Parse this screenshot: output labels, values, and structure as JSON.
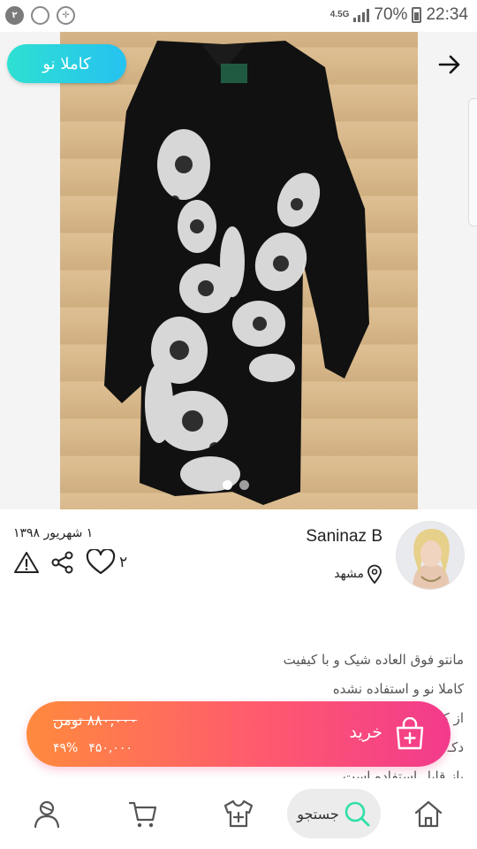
{
  "status_bar": {
    "notification_count": "۲",
    "network": "4.5G",
    "battery": "70%",
    "time": "22:34"
  },
  "product": {
    "badge": "کاملا نو",
    "image_alt": "embroidered black coat",
    "carousel_pages": 2,
    "carousel_active": 1
  },
  "seller": {
    "name": "Saninaz B",
    "city": "مشهد",
    "post_date": "۱ شهریور ۱۳۹۸",
    "likes": "۲"
  },
  "description": {
    "lines": [
      "مانتو فوق العاده شیک و با کیفیت",
      "کاملا نو و استفاده نشده",
      "از کـ",
      "دکـ",
      "باز قابل استفاده است"
    ]
  },
  "buy": {
    "label": "خرید",
    "old_price": "۸۸۰,۰۰۰ تومن",
    "new_price": "۴۵۰,۰۰۰",
    "discount": "۴۹%"
  },
  "nav": {
    "search_label": "جستجو"
  },
  "colors": {
    "accent_teal": "#2fe0d2",
    "buy_gradient_start": "#ff8a3d",
    "buy_gradient_end": "#f23a8c"
  }
}
